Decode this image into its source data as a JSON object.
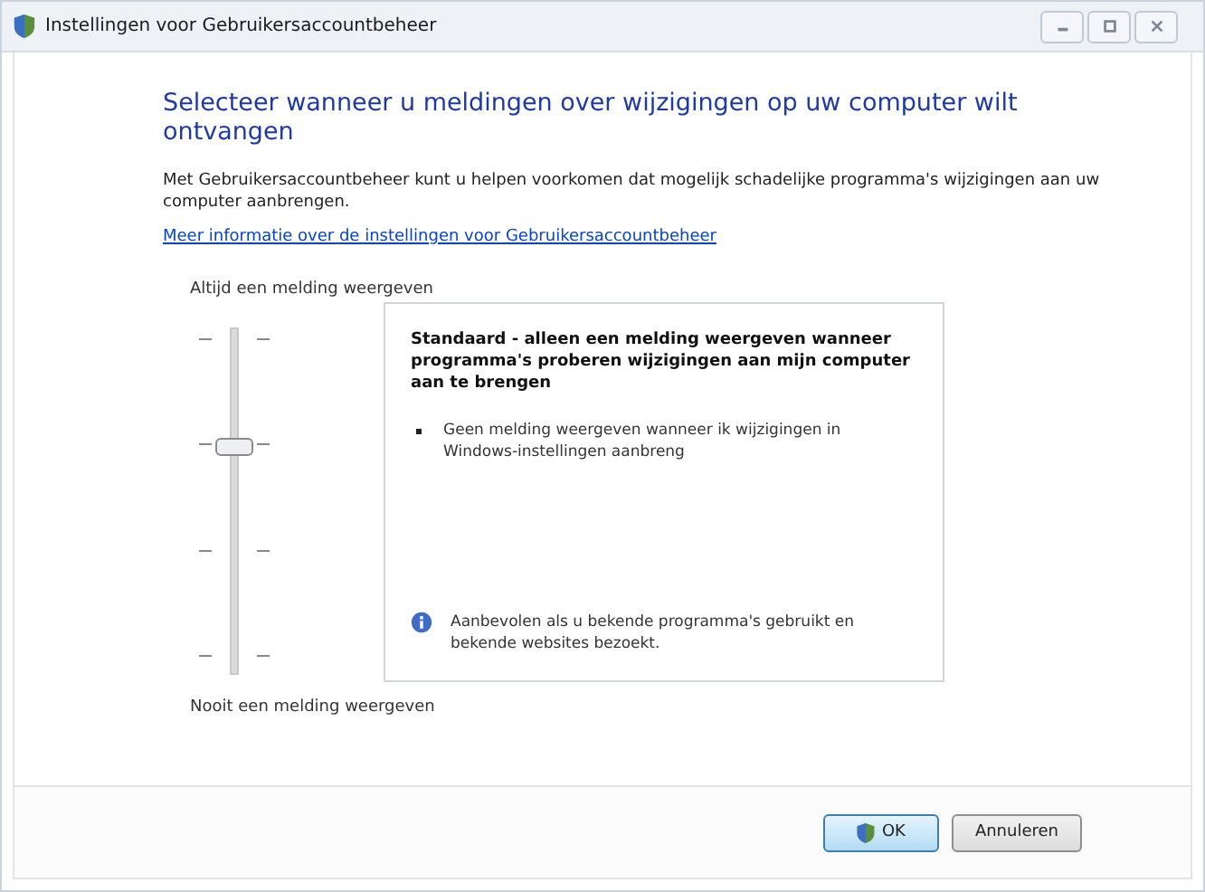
{
  "window": {
    "title": "Instellingen voor Gebruikersaccountbeheer"
  },
  "heading": "Selecteer wanneer u meldingen over wijzigingen op uw computer wilt ontvangen",
  "intro": "Met Gebruikersaccountbeheer kunt u helpen voorkomen dat mogelijk schadelijke programma's wijzigingen aan uw computer aanbrengen.",
  "info_link": "Meer informatie over de instellingen voor Gebruikersaccountbeheer",
  "slider": {
    "top_label": "Altijd een melding weergeven",
    "bottom_label": "Nooit een melding weergeven",
    "level": 0.667
  },
  "description": {
    "title": "Standaard - alleen een melding weergeven wanneer programma's proberen wijzigingen aan mijn computer aan te brengen",
    "bullets": [
      "Geen melding weergeven wanneer ik wijzigingen in Windows-instellingen aanbreng"
    ],
    "recommendation": "Aanbevolen als u bekende programma's gebruikt en bekende websites bezoekt."
  },
  "buttons": [
    {
      "label": "OK",
      "kind": "shield",
      "default": true
    },
    {
      "label": "Annuleren",
      "kind": "plain",
      "default": false
    }
  ]
}
